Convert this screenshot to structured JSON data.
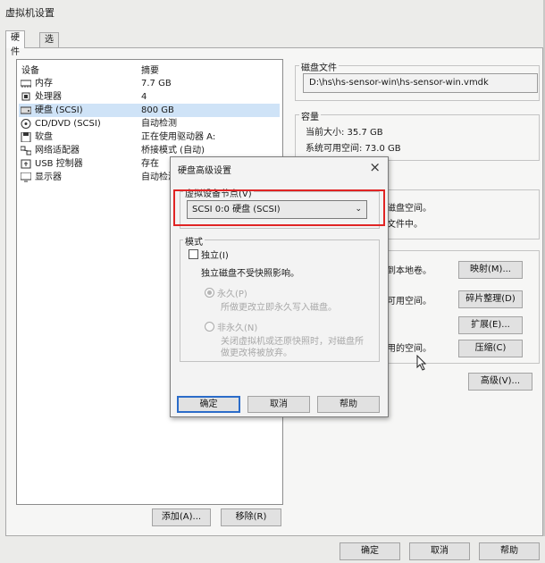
{
  "window": {
    "title": "虚拟机设置"
  },
  "tabs": [
    {
      "label": "硬件"
    },
    {
      "label": "选项"
    }
  ],
  "device_list": {
    "col_device": "设备",
    "col_summary": "摘要",
    "rows": [
      {
        "icon": "memory-icon",
        "name": "内存",
        "summary": "7.7 GB"
      },
      {
        "icon": "cpu-icon",
        "name": "处理器",
        "summary": "4"
      },
      {
        "icon": "hard-disk-icon",
        "name": "硬盘 (SCSI)",
        "summary": "800 GB"
      },
      {
        "icon": "cd-dvd-icon",
        "name": "CD/DVD (SCSI)",
        "summary": "自动检测"
      },
      {
        "icon": "floppy-icon",
        "name": "软盘",
        "summary": "正在使用驱动器 A:"
      },
      {
        "icon": "network-adapter-icon",
        "name": "网络适配器",
        "summary": "桥接模式 (自动)"
      },
      {
        "icon": "usb-icon",
        "name": "USB 控制器",
        "summary": "存在"
      },
      {
        "icon": "display-icon",
        "name": "显示器",
        "summary": "自动检测"
      }
    ]
  },
  "list_buttons": {
    "add": "添加(A)...",
    "remove": "移除(R)"
  },
  "disk_file": {
    "label": "磁盘文件",
    "value": "D:\\hs\\hs-sensor-win\\hs-sensor-win.vmdk"
  },
  "capacity": {
    "label": "容量",
    "current_size": "当前大小: 35.7 GB",
    "system_free": "系统可用空间: 73.0 GB"
  },
  "right_fragments": {
    "disk_space_1": "磁盘空间。",
    "disk_space_2": "文件中。",
    "map_text": "到本地卷。",
    "free_text": "可用空间。",
    "used_space_text": "用的空间。"
  },
  "utility_buttons": {
    "map": "映射(M)...",
    "defrag": "碎片整理(D)",
    "expand": "扩展(E)...",
    "compact": "压缩(C)",
    "advanced": "高级(V)..."
  },
  "dialog": {
    "title": "硬盘高级设置",
    "close_icon": "×",
    "node_label": "虚拟设备节点(V)",
    "node_value": "SCSI 0:0   硬盘 (SCSI)",
    "mode_label": "模式",
    "independent_label": "独立(I)",
    "independent_desc": "独立磁盘不受快照影响。",
    "persistent_label": "永久(P)",
    "persistent_desc": "所做更改立即永久写入磁盘。",
    "nonpersistent_label": "非永久(N)",
    "nonpersistent_desc_1": "关闭虚拟机或还原快照时，对磁盘所",
    "nonpersistent_desc_2": "做更改将被放弃。",
    "ok": "确定",
    "cancel": "取消",
    "help": "帮助"
  },
  "main_buttons": {
    "ok": "确定",
    "cancel": "取消",
    "help": "帮助"
  },
  "colors": {
    "highlight_box": "#e02424",
    "selected_row": "#cfe3f7",
    "default_button_border": "#2b6cc9"
  }
}
